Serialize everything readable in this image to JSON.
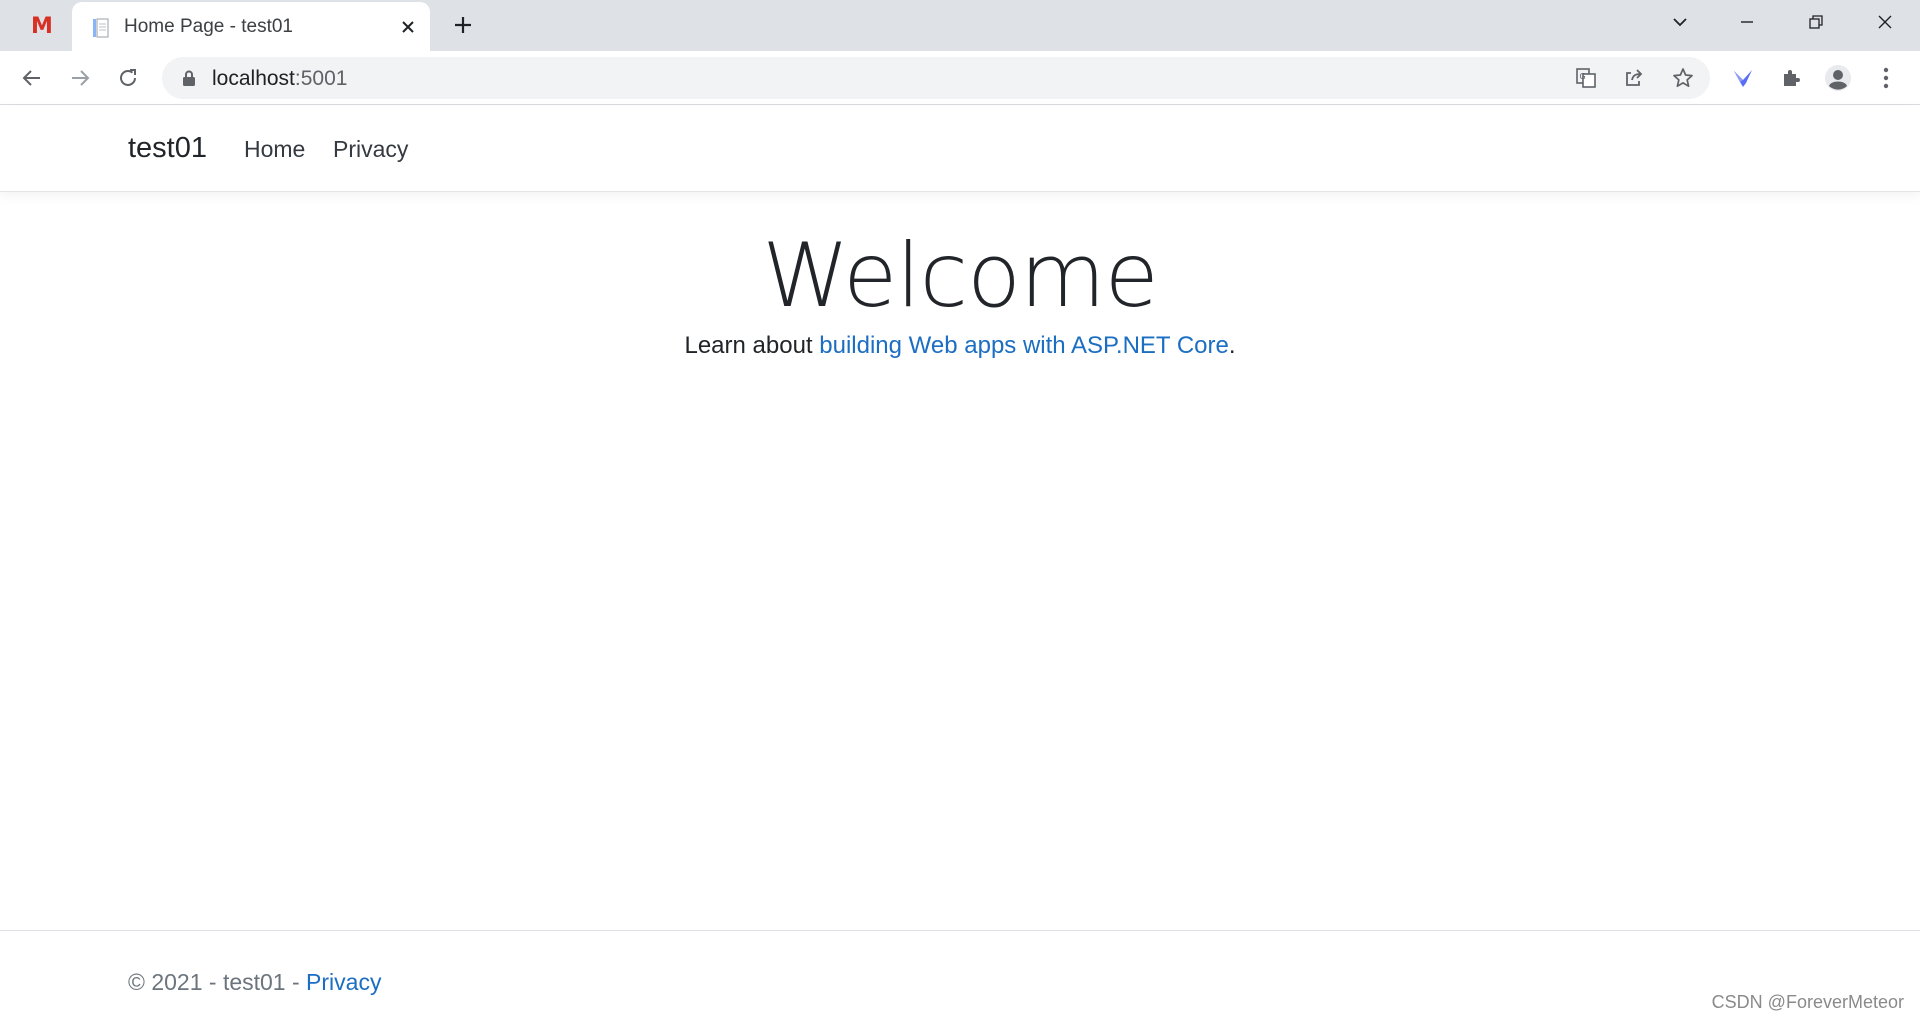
{
  "browser": {
    "pinned_tab_icon": "M",
    "active_tab": {
      "title": "Home Page - test01",
      "favicon": "document-icon"
    },
    "new_tab_symbol": "+",
    "address": {
      "host": "localhost",
      "port": ":5001"
    },
    "accent_colors": {
      "pinned": "#d93025",
      "extension": "#5a6ef5"
    }
  },
  "site": {
    "brand": "test01",
    "nav": {
      "home": "Home",
      "privacy": "Privacy"
    }
  },
  "main": {
    "heading": "Welcome",
    "learn_prefix": "Learn about ",
    "learn_link": "building Web apps with ASP.NET Core",
    "learn_suffix": "."
  },
  "footer": {
    "copyright": "© 2021 - test01 - ",
    "privacy_link": "Privacy",
    "link_color": "#1b6ec2"
  },
  "watermark": "CSDN @ForeverMeteor"
}
